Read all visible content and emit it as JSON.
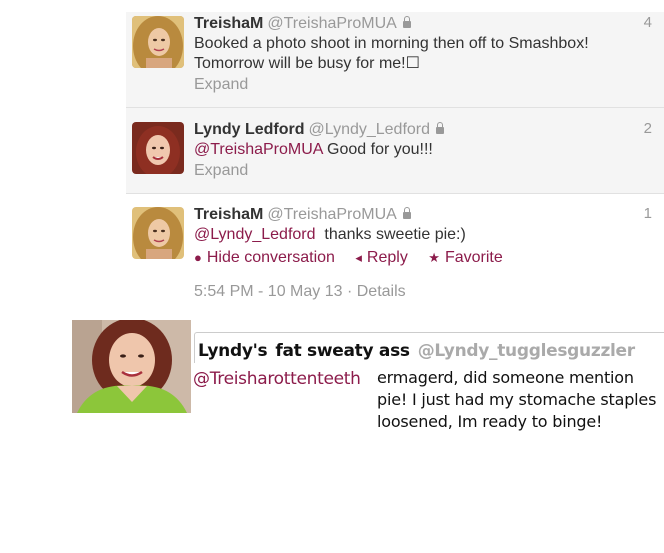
{
  "tweets": [
    {
      "name": "TreishaM",
      "handle": "@TreishaProMUA",
      "text": "Booked a photo shoot in morning then off to Smashbox! Tomorrow will be busy for me!☐",
      "expand": "Expand",
      "time_fragment": "4"
    },
    {
      "name": "Lyndy Ledford",
      "handle": "@Lyndy_Ledford",
      "mention": "@TreishaProMUA",
      "text": "Good for you!!!",
      "expand": "Expand",
      "time_fragment": "2"
    },
    {
      "name": "TreishaM",
      "handle": "@TreishaProMUA",
      "mention": "@Lyndy_Ledford",
      "text": "thanks sweetie pie:)",
      "actions": {
        "hide": "Hide conversation",
        "reply": "Reply",
        "favorite": "Favorite"
      },
      "timestamp": "5:54 PM - 10 May 13",
      "details": "Details",
      "time_fragment": "1"
    }
  ],
  "parody": {
    "name_part1": "Lyndy's",
    "name_part2": "fat sweaty ass",
    "handle": "@Lyndy_tugglesguzzler",
    "mention": "@Treisharottenteeth",
    "text": "ermagerd, did someone mention pie! I just had my stomache staples loosened, Im ready to binge!"
  },
  "colors": {
    "mention": "#8c1c4b",
    "muted": "#999999",
    "panel": "#f5f5f5"
  }
}
